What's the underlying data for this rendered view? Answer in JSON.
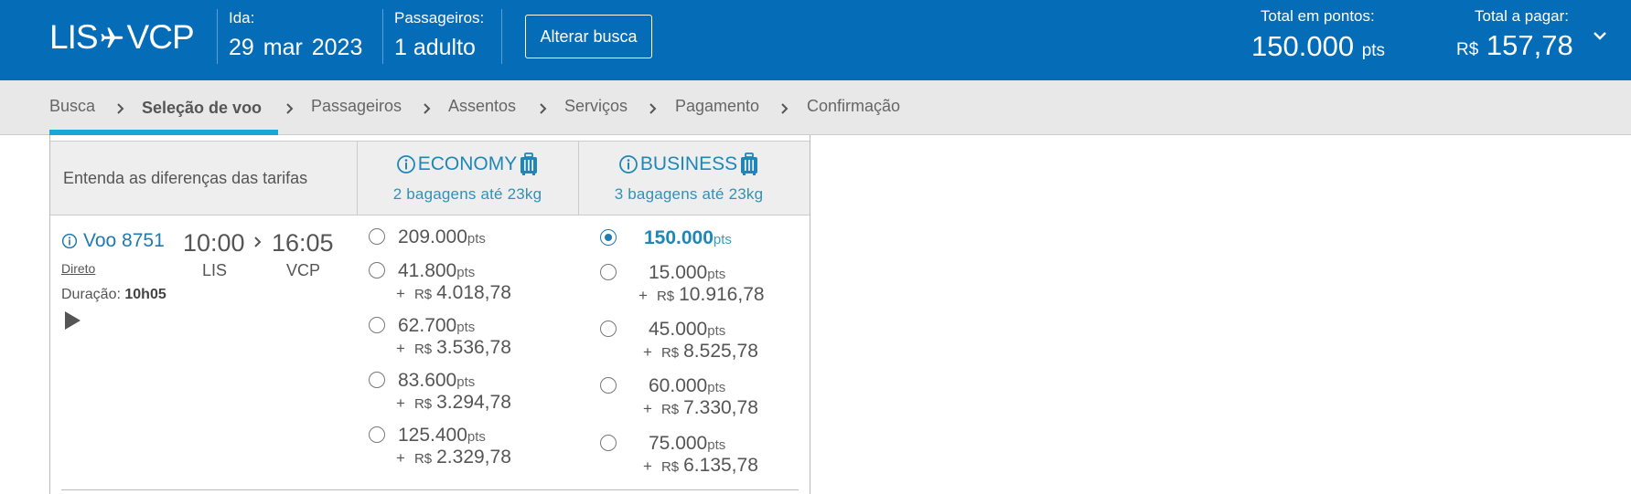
{
  "header": {
    "route_from": "LIS",
    "route_to": "VCP",
    "ida_label": "Ida:",
    "ida_value": "29  mar  2023",
    "passengers_label": "Passageiros:",
    "passengers_value": "1 adulto",
    "alter_button": "Alterar busca",
    "total_points_label": "Total em pontos:",
    "total_points_value": "150.000",
    "total_points_unit": "pts",
    "total_pay_label": "Total a pagar:",
    "total_pay_currency": "R$",
    "total_pay_value": "157,78"
  },
  "breadcrumb": [
    {
      "label": "Busca",
      "active": false
    },
    {
      "label": "Seleção de voo",
      "active": true
    },
    {
      "label": "Passageiros",
      "active": false
    },
    {
      "label": "Assentos",
      "active": false
    },
    {
      "label": "Serviços",
      "active": false
    },
    {
      "label": "Pagamento",
      "active": false
    },
    {
      "label": "Confirmação",
      "active": false
    }
  ],
  "table": {
    "header_text": "Entenda as diferenças das tarifas",
    "economy": {
      "title": "ECONOMY",
      "subtitle": "2 bagagens até 23kg"
    },
    "business": {
      "title": "BUSINESS",
      "subtitle": "3 bagagens até 23kg"
    }
  },
  "flight": {
    "number": "Voo 8751",
    "type": "Direto",
    "duration_label": "Duração:",
    "duration_value": "10h05",
    "depart_time": "10:00",
    "arrive_time": "16:05",
    "origin": "LIS",
    "destination": "VCP"
  },
  "economy_options": [
    {
      "points": "209.000",
      "unit": "pts",
      "currency": "",
      "money": "",
      "selected": false
    },
    {
      "points": "41.800",
      "unit": "pts",
      "currency": "R$",
      "money": "4.018,78",
      "selected": false
    },
    {
      "points": "62.700",
      "unit": "pts",
      "currency": "R$",
      "money": "3.536,78",
      "selected": false
    },
    {
      "points": "83.600",
      "unit": "pts",
      "currency": "R$",
      "money": "3.294,78",
      "selected": false
    },
    {
      "points": "125.400",
      "unit": "pts",
      "currency": "R$",
      "money": "2.329,78",
      "selected": false
    }
  ],
  "business_options": [
    {
      "points": "150.000",
      "unit": "pts",
      "currency": "",
      "money": "",
      "selected": true
    },
    {
      "points": "15.000",
      "unit": "pts",
      "currency": "R$",
      "money": "10.916,78",
      "selected": false
    },
    {
      "points": "45.000",
      "unit": "pts",
      "currency": "R$",
      "money": "8.525,78",
      "selected": false
    },
    {
      "points": "60.000",
      "unit": "pts",
      "currency": "R$",
      "money": "7.330,78",
      "selected": false
    },
    {
      "points": "75.000",
      "unit": "pts",
      "currency": "R$",
      "money": "6.135,78",
      "selected": false
    }
  ],
  "plus_sign": "+",
  "colors": {
    "header_bg": "#056cb8",
    "accent": "#1f87b8",
    "underline": "#17a8d8",
    "crumb_bg": "#e8e8e8"
  },
  "icons": [
    "plane-icon",
    "chevron-down-icon",
    "chevron-right-icon",
    "info-icon",
    "luggage-icon",
    "play-icon"
  ]
}
